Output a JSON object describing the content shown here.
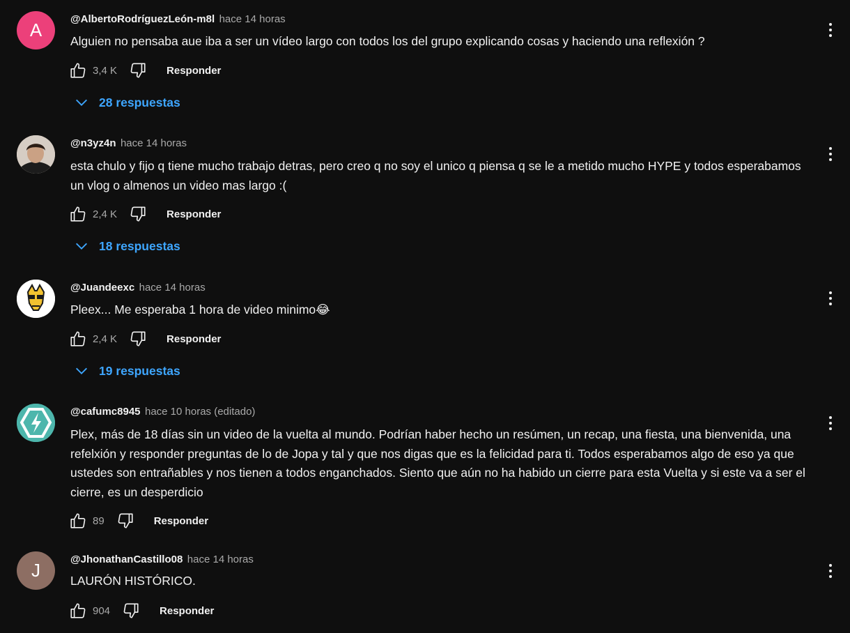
{
  "comments": [
    {
      "author": "@AlbertoRodríguezLeón-m8l",
      "time": "hace 14 horas",
      "text": "Alguien no pensaba aue iba a ser un vídeo largo con todos los del grupo explicando cosas y haciendo una reflexión ?",
      "likes": "3,4 K",
      "reply_label": "Responder",
      "replies_label": "28 respuestas",
      "avatar": {
        "letter": "A",
        "color": "#ec407a",
        "type": "letter"
      }
    },
    {
      "author": "@n3yz4n",
      "time": "hace 14 horas",
      "text": "esta chulo y fijo q tiene mucho trabajo detras, pero creo q no soy el unico q piensa q se le a metido mucho HYPE y todos esperabamos un vlog o almenos un video mas largo :(",
      "likes": "2,4 K",
      "reply_label": "Responder",
      "replies_label": "18 respuestas",
      "avatar": {
        "type": "photo-face"
      }
    },
    {
      "author": "@Juandeexc",
      "time": "hace 14 horas",
      "text": "Pleex... Me esperaba 1 hora de video minimo😂",
      "likes": "2,4 K",
      "reply_label": "Responder",
      "replies_label": "19 respuestas",
      "avatar": {
        "type": "giraffe-logo"
      }
    },
    {
      "author": "@cafumc8945",
      "time": "hace 10 horas (editado)",
      "text": "Plex, más de 18 días sin un video de la vuelta al mundo. Podrían haber hecho un resúmen, un recap, una fiesta, una bienvenida, una refelxión y responder preguntas de lo de Jopa y tal y que nos digas que es la felicidad para ti. Todos esperabamos algo de eso ya que ustedes son entrañables y nos tienen a todos enganchados. Siento que aún no ha habido un cierre para esta Vuelta y si este va a ser el cierre, es un desperdicio",
      "likes": "89",
      "reply_label": "Responder",
      "avatar": {
        "type": "lightning-logo",
        "color": "#4db6ac"
      }
    },
    {
      "author": "@JhonathanCastillo08",
      "time": "hace 14 horas",
      "text": "LAURÓN HISTÓRICO.",
      "likes": "904",
      "reply_label": "Responder",
      "avatar": {
        "letter": "J",
        "color": "#8d6e63",
        "type": "letter"
      }
    }
  ],
  "icons": {
    "like": "thumb-up-icon",
    "dislike": "thumb-down-icon",
    "menu": "more-vert-icon",
    "expand": "chevron-down-icon"
  }
}
